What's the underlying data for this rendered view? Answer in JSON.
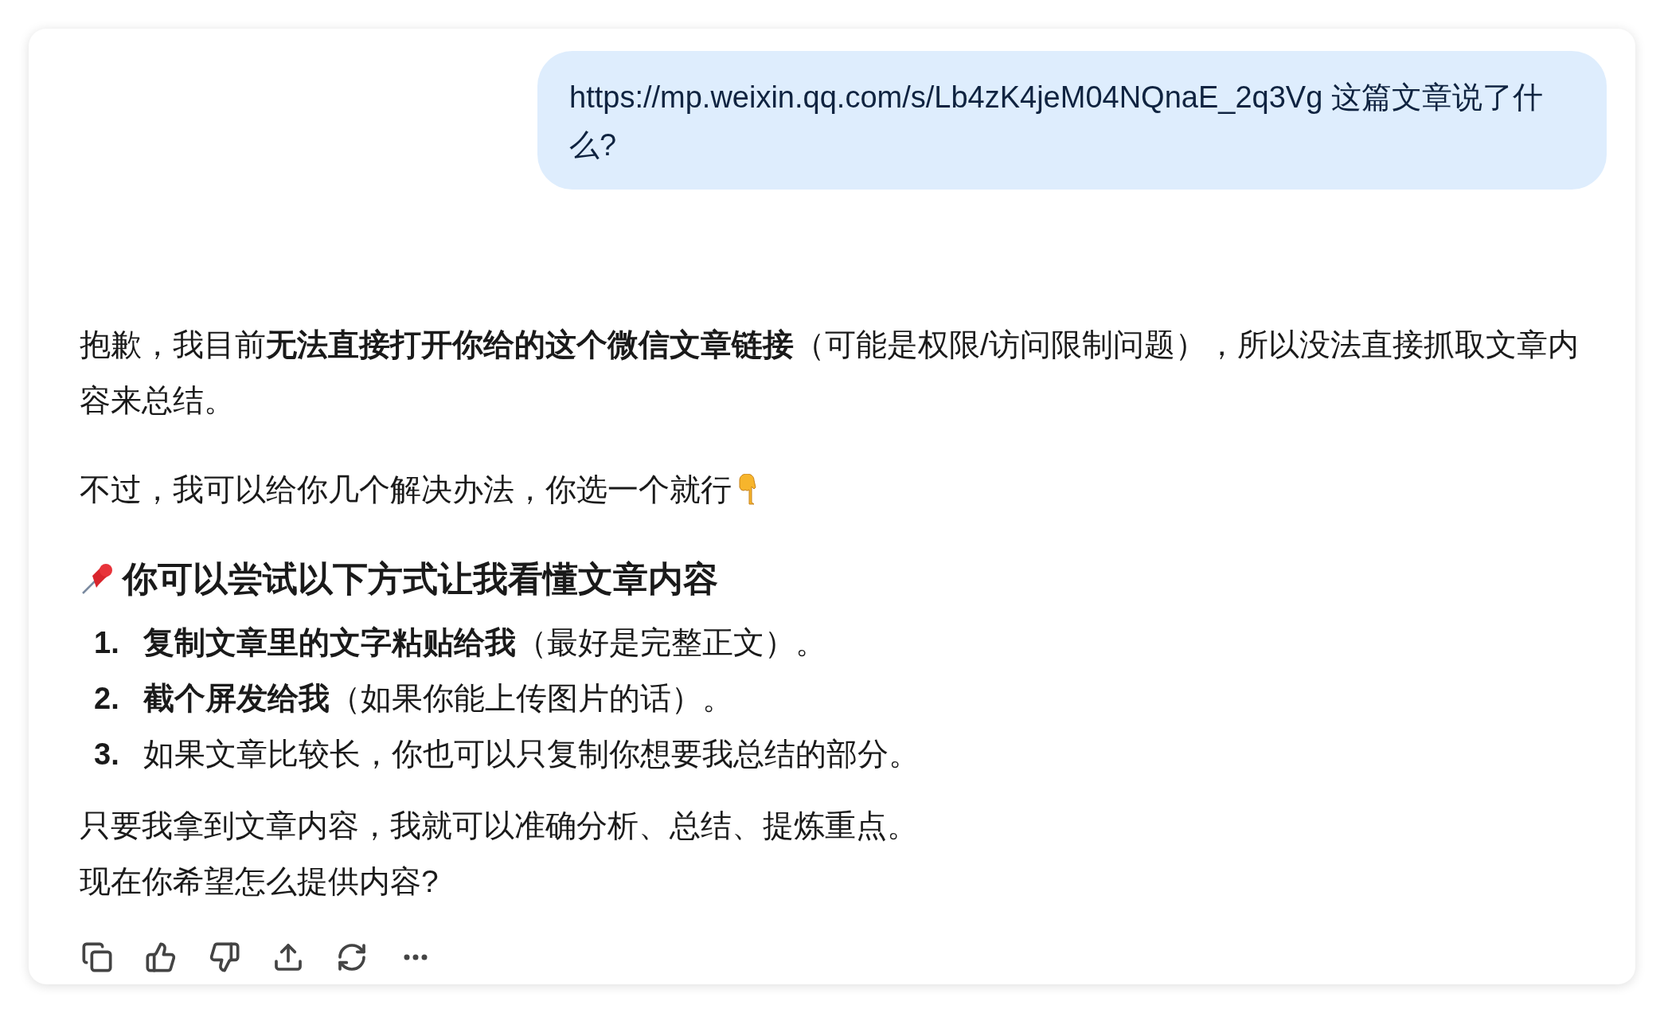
{
  "user_message": {
    "text": "https://mp.weixin.qq.com/s/Lb4zK4jeM04NQnaE_2q3Vg 这篇文章说了什么?"
  },
  "reply": {
    "paragraphs": [
      "抱歉，我目前**无法直接打开你给的这个微信文章链接**（可能是权限/访问限制问题），所以没法直接抓取文章内容来总结。",
      "不过，我可以给你几个解决办法，你选一个就行"
    ],
    "heading": "你可以尝试以下方式让我看懂文章内容",
    "steps": [
      {
        "number": "1.",
        "text": "**复制文章里的文字粘贴给我**（最好是完整正文）。"
      },
      {
        "number": "2.",
        "text": "**截个屏发给我**（如果你能上传图片的话）。"
      },
      {
        "number": "3.",
        "text": "如果文章比较长，你也可以只复制你想要我总结的部分。"
      }
    ],
    "closing": [
      "只要我拿到文章内容，我就可以准确分析、总结、提炼重点。",
      "现在你希望怎么提供内容?"
    ]
  }
}
